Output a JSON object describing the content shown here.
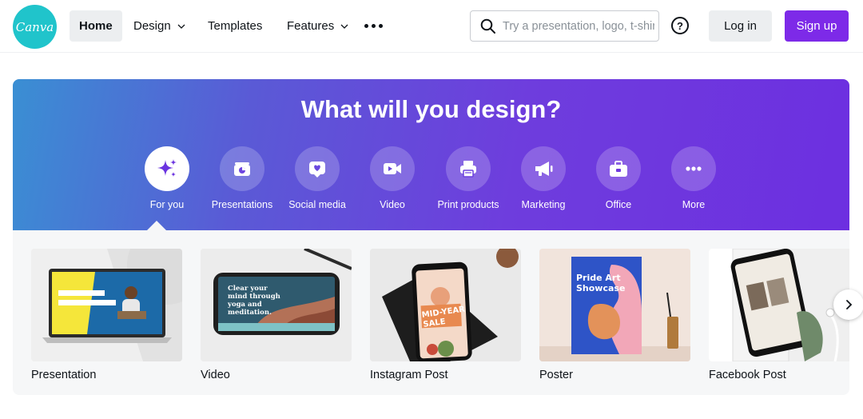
{
  "header": {
    "logo_text": "Canva",
    "nav": [
      {
        "label": "Home",
        "active": true,
        "dropdown": false
      },
      {
        "label": "Design",
        "active": false,
        "dropdown": true
      },
      {
        "label": "Templates",
        "active": false,
        "dropdown": false
      },
      {
        "label": "Features",
        "active": false,
        "dropdown": true
      }
    ],
    "more_icon": "ellipsis-icon",
    "search": {
      "placeholder": "Try a presentation, logo, t-shirt",
      "value": ""
    },
    "help_label": "?",
    "login_label": "Log in",
    "signup_label": "Sign up"
  },
  "hero": {
    "title": "What will you design?",
    "categories": [
      {
        "label": "For you",
        "icon": "sparkles-icon",
        "active": true
      },
      {
        "label": "Presentations",
        "icon": "presentation-icon",
        "active": false
      },
      {
        "label": "Social media",
        "icon": "heart-icon",
        "active": false
      },
      {
        "label": "Video",
        "icon": "video-camera-icon",
        "active": false
      },
      {
        "label": "Print products",
        "icon": "printer-icon",
        "active": false
      },
      {
        "label": "Marketing",
        "icon": "megaphone-icon",
        "active": false
      },
      {
        "label": "Office",
        "icon": "briefcase-icon",
        "active": false
      },
      {
        "label": "More",
        "icon": "ellipsis-icon",
        "active": false
      }
    ]
  },
  "cards": [
    {
      "label": "Presentation"
    },
    {
      "label": "Video",
      "thumb_text": "Clear your mind through yoga and meditation."
    },
    {
      "label": "Instagram Post",
      "thumb_text": "MID-YEAR SALE"
    },
    {
      "label": "Poster",
      "thumb_text": "Pride Art Showcase"
    },
    {
      "label": "Facebook Post"
    }
  ],
  "colors": {
    "brand_purple": "#7d2ae8",
    "logo_teal": "#20c4cb",
    "hero_start": "#3a8fd3",
    "hero_end": "#6d2fe0"
  }
}
